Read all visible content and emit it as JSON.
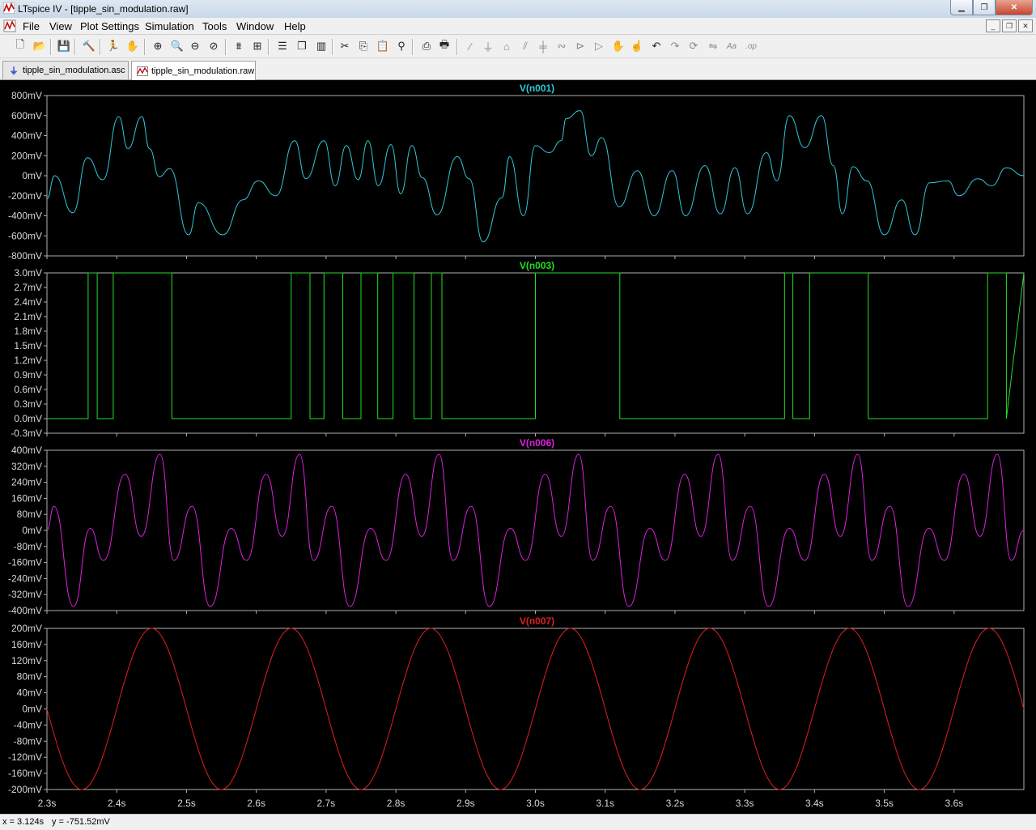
{
  "window": {
    "title": "LTspice IV - [tipple_sin_modulation.raw]"
  },
  "menu": [
    "File",
    "View",
    "Plot Settings",
    "Simulation",
    "Tools",
    "Window",
    "Help"
  ],
  "tabs": [
    {
      "label": "tipple_sin_modulation.asc",
      "active": false
    },
    {
      "label": "tipple_sin_modulation.raw",
      "active": true
    }
  ],
  "toolbar": {
    "icons": [
      "new-schematic-icon",
      "open-icon",
      "save-icon",
      "control-panel-icon",
      "run-icon",
      "halt-icon",
      "zoom-in-icon",
      "zoom-area-icon",
      "zoom-out-icon",
      "zoom-cancel-icon",
      "autorange-icon",
      "mark-unconnected-icon",
      "tile-horizontal-icon",
      "cascade-icon",
      "tile-vertical-icon",
      "cut-icon",
      "copy-icon",
      "paste-icon",
      "find-icon",
      "print-setup-icon",
      "print-icon",
      "wire-icon",
      "ground-icon",
      "label-icon",
      "resistor-icon",
      "capacitor-icon",
      "inductor-icon",
      "diode-icon",
      "component-icon",
      "move-icon",
      "drag-icon",
      "undo-icon",
      "redo-icon",
      "rotate-icon",
      "mirror-icon",
      "text-icon",
      "spice-directive-icon"
    ]
  },
  "status": {
    "x": "x = 3.124s",
    "y": "y = -751.52mV"
  },
  "chart_data": {
    "type": "line",
    "xlim": [
      2.3,
      3.7
    ],
    "x_ticks": [
      "2.3s",
      "2.4s",
      "2.5s",
      "2.6s",
      "2.7s",
      "2.8s",
      "2.9s",
      "3.0s",
      "3.1s",
      "3.2s",
      "3.3s",
      "3.4s",
      "3.5s",
      "3.6s"
    ],
    "x_tick_values": [
      2.3,
      2.4,
      2.5,
      2.6,
      2.7,
      2.8,
      2.9,
      3.0,
      3.1,
      3.2,
      3.3,
      3.4,
      3.5,
      3.6
    ],
    "background": "#000000",
    "panes": [
      {
        "name": "V(n001)",
        "color": "#30c8d8",
        "ylim": [
          -800,
          800
        ],
        "y_ticks": [
          "800mV",
          "600mV",
          "400mV",
          "200mV",
          "0mV",
          "-200mV",
          "-400mV",
          "-600mV",
          "-800mV"
        ],
        "y_tick_values": [
          800,
          600,
          400,
          200,
          0,
          -200,
          -400,
          -600,
          -800
        ],
        "x": [
          2.3,
          2.311,
          2.337,
          2.358,
          2.38,
          2.403,
          2.416,
          2.436,
          2.447,
          2.461,
          2.476,
          2.503,
          2.517,
          2.552,
          2.581,
          2.603,
          2.628,
          2.655,
          2.671,
          2.697,
          2.713,
          2.729,
          2.746,
          2.76,
          2.775,
          2.793,
          2.807,
          2.823,
          2.838,
          2.859,
          2.888,
          2.905,
          2.925,
          2.952,
          2.963,
          2.983,
          3.0,
          3.02,
          3.037,
          3.044,
          3.064,
          3.08,
          3.095,
          3.12,
          3.146,
          3.17,
          3.196,
          3.215,
          3.243,
          3.265,
          3.286,
          3.304,
          3.331,
          3.346,
          3.364,
          3.386,
          3.41,
          3.427,
          3.44,
          3.455,
          3.475,
          3.5,
          3.525,
          3.544,
          3.565,
          3.591,
          3.607,
          3.634,
          3.654,
          3.675,
          3.7
        ],
        "values": [
          -230,
          0,
          -370,
          180,
          -40,
          590,
          270,
          590,
          270,
          -10,
          70,
          -590,
          -270,
          -590,
          -240,
          -50,
          -200,
          350,
          -30,
          350,
          -100,
          300,
          -40,
          350,
          -100,
          310,
          -180,
          300,
          -20,
          -390,
          190,
          -30,
          -660,
          -220,
          190,
          -400,
          300,
          230,
          350,
          570,
          650,
          200,
          380,
          -310,
          50,
          -400,
          50,
          -400,
          100,
          -380,
          80,
          -380,
          230,
          -50,
          600,
          280,
          600,
          100,
          -380,
          90,
          -50,
          -590,
          -240,
          -590,
          -70,
          -50,
          -200,
          -30,
          -100,
          80,
          0
        ]
      },
      {
        "name": "V(n003)",
        "color": "#20e020",
        "ylim": [
          -0.3,
          3.0
        ],
        "y_ticks": [
          "3.0mV",
          "2.7mV",
          "2.4mV",
          "2.1mV",
          "1.8mV",
          "1.5mV",
          "1.2mV",
          "0.9mV",
          "0.6mV",
          "0.3mV",
          "0.0mV",
          "-0.3mV"
        ],
        "y_tick_values": [
          3.0,
          2.7,
          2.4,
          2.1,
          1.8,
          1.5,
          1.2,
          0.9,
          0.6,
          0.3,
          0.0,
          -0.3
        ],
        "x": [
          2.3,
          2.359,
          2.359,
          2.372,
          2.372,
          2.395,
          2.395,
          2.479,
          2.479,
          2.65,
          2.65,
          2.677,
          2.677,
          2.697,
          2.697,
          2.724,
          2.724,
          2.75,
          2.75,
          2.774,
          2.774,
          2.796,
          2.796,
          2.826,
          2.826,
          2.851,
          2.851,
          2.866,
          2.866,
          3.0,
          3.0,
          3.121,
          3.121,
          3.357,
          3.357,
          3.369,
          3.369,
          3.393,
          3.393,
          3.477,
          3.477,
          3.648,
          3.648,
          3.675,
          3.675,
          3.7
        ],
        "values": [
          0,
          0,
          3,
          3,
          0,
          0,
          3,
          3,
          0,
          0,
          3,
          3,
          0,
          0,
          3,
          3,
          0,
          0,
          3,
          3,
          0,
          0,
          3,
          3,
          0,
          0,
          3,
          3,
          0,
          0,
          3,
          3,
          0,
          0,
          3,
          3,
          0,
          0,
          3,
          3,
          0,
          0,
          3,
          3,
          0,
          3
        ]
      },
      {
        "name": "V(n006)",
        "color": "#e020e0",
        "ylim": [
          -400,
          400
        ],
        "y_ticks": [
          "400mV",
          "320mV",
          "240mV",
          "160mV",
          "80mV",
          "0mV",
          "-80mV",
          "-160mV",
          "-240mV",
          "-320mV",
          "-400mV"
        ],
        "y_tick_values": [
          400,
          320,
          240,
          160,
          80,
          0,
          -80,
          -160,
          -240,
          -320,
          -400
        ],
        "x": [
          2.3,
          2.31,
          2.338,
          2.362,
          2.381,
          2.412,
          2.435,
          2.462,
          2.482,
          2.508,
          2.534,
          2.564,
          2.586,
          2.614,
          2.637,
          2.662,
          2.682,
          2.708,
          2.734,
          2.764,
          2.786,
          2.814,
          2.837,
          2.862,
          2.882,
          2.908,
          2.934,
          2.964,
          2.986,
          3.014,
          3.037,
          3.062,
          3.082,
          3.108,
          3.134,
          3.164,
          3.186,
          3.214,
          3.237,
          3.262,
          3.282,
          3.308,
          3.334,
          3.364,
          3.386,
          3.414,
          3.437,
          3.462,
          3.482,
          3.508,
          3.534,
          3.564,
          3.586,
          3.614,
          3.637,
          3.662,
          3.682,
          3.7
        ],
        "values": [
          0,
          120,
          -380,
          10,
          -150,
          280,
          -30,
          380,
          -150,
          120,
          -380,
          10,
          -150,
          280,
          -30,
          380,
          -150,
          120,
          -380,
          10,
          -150,
          280,
          -30,
          380,
          -150,
          120,
          -380,
          10,
          -150,
          280,
          -30,
          380,
          -150,
          120,
          -380,
          10,
          -150,
          280,
          -30,
          380,
          -150,
          120,
          -380,
          10,
          -150,
          280,
          -30,
          380,
          -150,
          120,
          -380,
          10,
          -150,
          280,
          -30,
          380,
          -150,
          0
        ]
      },
      {
        "name": "V(n007)",
        "color": "#e02020",
        "ylim": [
          -200,
          200
        ],
        "y_ticks": [
          "200mV",
          "160mV",
          "120mV",
          "80mV",
          "40mV",
          "0mV",
          "-40mV",
          "-80mV",
          "-120mV",
          "-160mV",
          "-200mV"
        ],
        "y_tick_values": [
          200,
          160,
          120,
          80,
          40,
          0,
          -40,
          -80,
          -120,
          -160,
          -200
        ],
        "sine": {
          "amplitude": 200,
          "frequency_hz": 5,
          "phase_reference_s": 2.3,
          "sign": -1
        }
      }
    ]
  }
}
